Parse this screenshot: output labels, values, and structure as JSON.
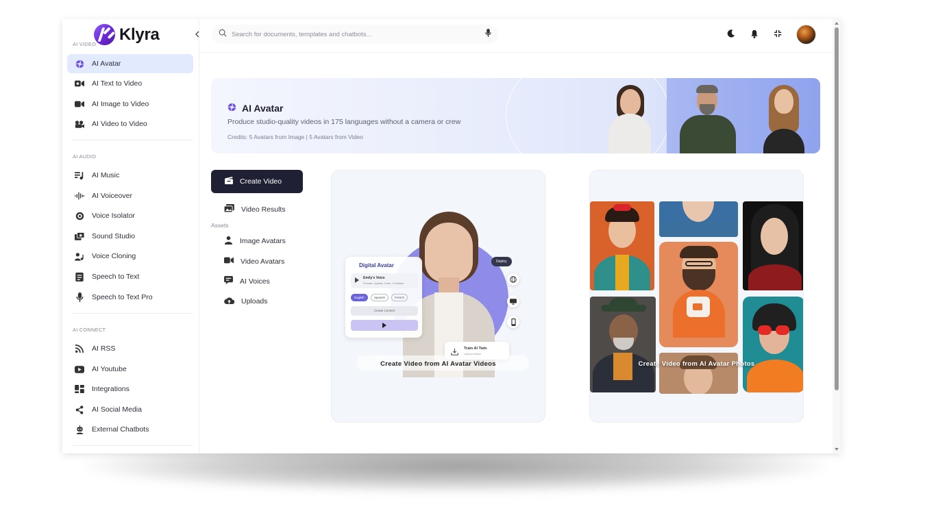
{
  "brand": {
    "name": "Klyra"
  },
  "sidebar": {
    "sections": [
      {
        "label": "AI VIDEO"
      },
      {
        "label": "AI AUDIO"
      },
      {
        "label": "AI CONNECT"
      }
    ],
    "items": [
      {
        "label": "AI Avatar",
        "icon": "aperture-icon"
      },
      {
        "label": "AI Text to Video",
        "icon": "video-camera-icon"
      },
      {
        "label": "AI Image to Video",
        "icon": "video-camera-icon"
      },
      {
        "label": "AI Video to Video",
        "icon": "film-reel-icon"
      },
      {
        "label": "AI Music",
        "icon": "music-list-icon"
      },
      {
        "label": "AI Voiceover",
        "icon": "waveform-icon"
      },
      {
        "label": "Voice Isolator",
        "icon": "target-icon"
      },
      {
        "label": "Sound Studio",
        "icon": "studio-icon"
      },
      {
        "label": "Voice Cloning",
        "icon": "user-music-icon"
      },
      {
        "label": "Speech to Text",
        "icon": "document-text-icon"
      },
      {
        "label": "Speech to Text Pro",
        "icon": "microphone-icon"
      },
      {
        "label": "AI RSS",
        "icon": "rss-icon"
      },
      {
        "label": "AI Youtube",
        "icon": "youtube-icon"
      },
      {
        "label": "Integrations",
        "icon": "integrations-icon"
      },
      {
        "label": "AI Social Media",
        "icon": "share-icon"
      },
      {
        "label": "External Chatbots",
        "icon": "robot-icon"
      }
    ]
  },
  "header": {
    "search_placeholder": "Search for documents, templates and chatbots..."
  },
  "banner": {
    "title": "AI Avatar",
    "subtitle": "Produce studio-quality videos in 175 languages without a camera or crew",
    "credits": "Credits: 5 Avatars from Image | 5 Avatars from Video"
  },
  "tabs": {
    "create_video": "Create Video",
    "video_results": "Video Results",
    "assets_label": "Assets",
    "image_avatars": "Image Avatars",
    "video_avatars": "Video Avatars",
    "ai_voices": "AI Voices",
    "uploads": "Uploads"
  },
  "cards": {
    "left_caption": "Create Video from AI Avatar Videos",
    "right_caption": "Create Video from AI Avatar Photos"
  },
  "digital_avatar": {
    "title": "Digital Avatar",
    "voice_name": "Emily's Voice",
    "voice_meta": "Female, Upbeat, Calm, Confident",
    "languages": [
      "English",
      "Spanish",
      "French"
    ],
    "create_label": "Create Content",
    "deploy_label": "Deploy",
    "twin_title": "Train AI Twin",
    "twin_sub": "Upload Avatar"
  },
  "colors": {
    "accent": "#6d4fe0",
    "active_bg": "#e2ebfd",
    "dark_button": "#1f2033"
  }
}
